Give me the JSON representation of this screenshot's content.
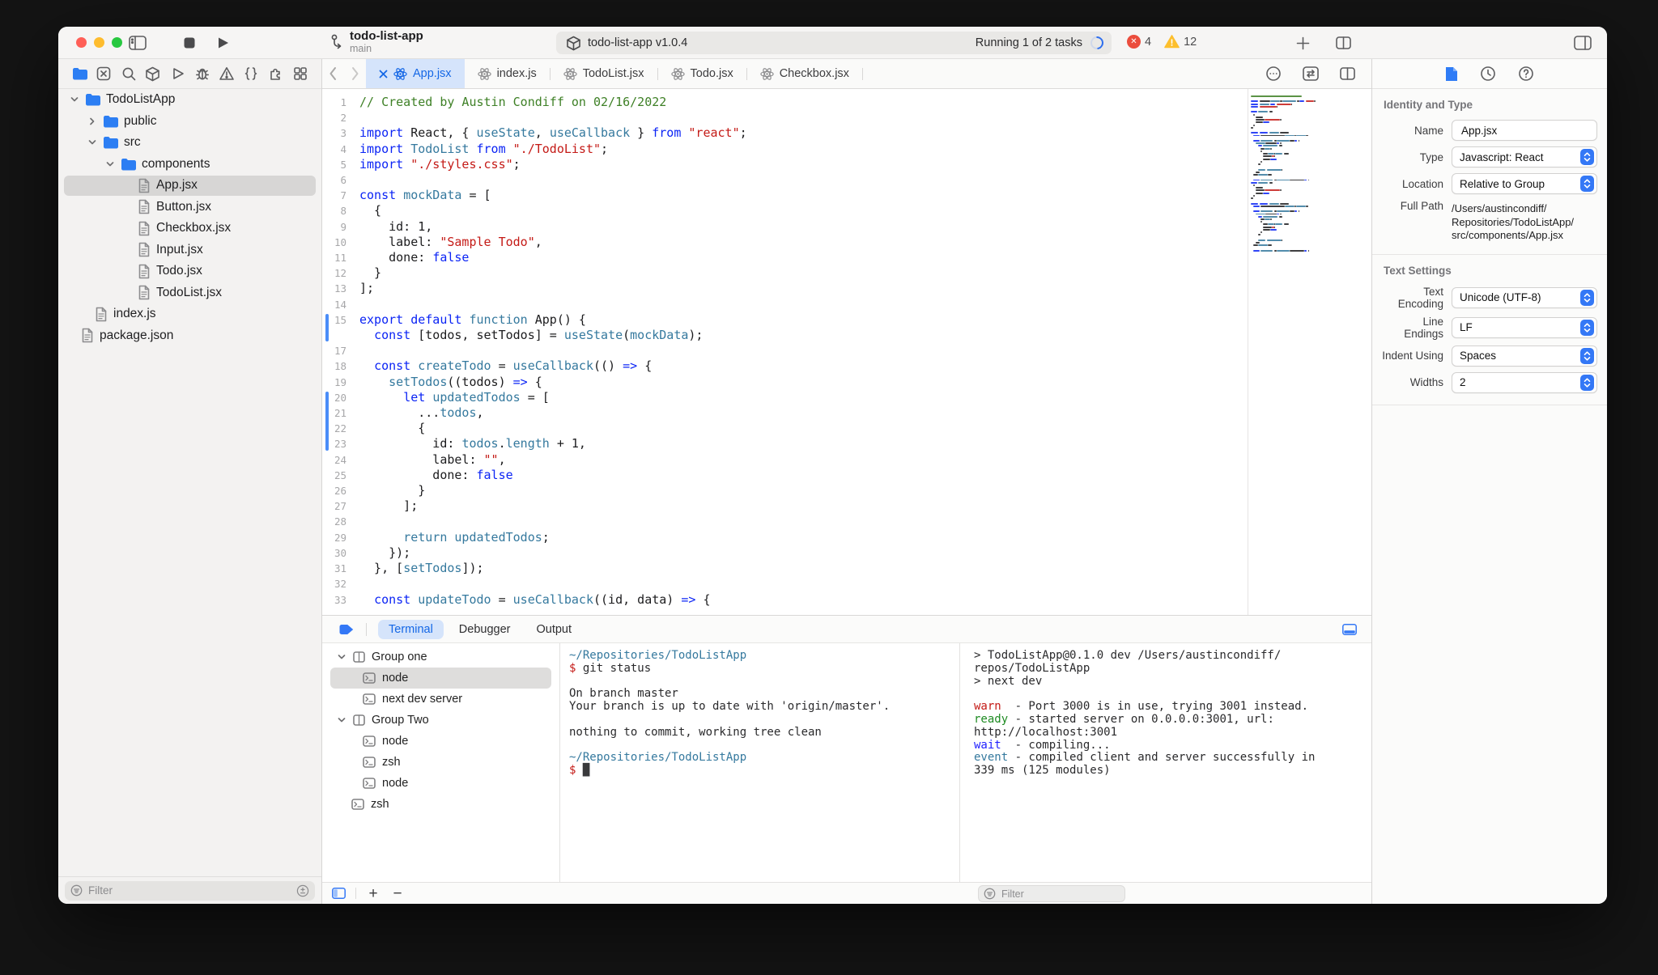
{
  "colors": {
    "accent": "#3478f6",
    "selection": "#d5e4fb",
    "traffic": [
      "#ff5f57",
      "#febc2e",
      "#28c840"
    ],
    "error_badge": "#eb4d3d",
    "warning_badge": "#fdbf2d",
    "code": {
      "p": "#1c1c1e",
      "kw": "#0b24f5",
      "fn": "#35799e",
      "str": "#c41a16",
      "c": "#3e8026"
    },
    "term": {
      "t": "#2a2a2c",
      "path": "#35799e",
      "dollar": "#c41a16",
      "warn": "#c41a16",
      "ready": "#1e8b22",
      "wait": "#1f1fff",
      "event": "#35799e",
      "cursor": "#3a3a3c"
    }
  },
  "toolbar": {
    "project_name": "todo-list-app",
    "branch": "main",
    "status": {
      "package_label": "todo-list-app v1.0.4",
      "running_label": "Running 1 of 2 tasks",
      "error_count": "4",
      "warning_count": "12"
    }
  },
  "navigator": {
    "icons": [
      "folder",
      "x-square",
      "search",
      "cube",
      "play",
      "bug",
      "warning",
      "braces",
      "puzzle",
      "grid"
    ],
    "tree": [
      {
        "label": "TodoListApp",
        "icon": "folder",
        "chevron": "down",
        "indent": 14
      },
      {
        "label": "public",
        "icon": "folder",
        "chevron": "right",
        "indent": 36
      },
      {
        "label": "src",
        "icon": "folder",
        "chevron": "down",
        "indent": 36
      },
      {
        "label": "components",
        "icon": "folder",
        "chevron": "down",
        "indent": 58
      },
      {
        "label": "App.jsx",
        "icon": "file",
        "indent": 98,
        "selected": true
      },
      {
        "label": "Button.jsx",
        "icon": "file",
        "indent": 98
      },
      {
        "label": "Checkbox.jsx",
        "icon": "file",
        "indent": 98
      },
      {
        "label": "Input.jsx",
        "icon": "file",
        "indent": 98
      },
      {
        "label": "Todo.jsx",
        "icon": "file",
        "indent": 98
      },
      {
        "label": "TodoList.jsx",
        "icon": "file",
        "indent": 98
      },
      {
        "label": "index.js",
        "icon": "file",
        "indent": 45
      },
      {
        "label": "package.json",
        "icon": "file",
        "indent": 28
      }
    ],
    "filter_placeholder": "Filter"
  },
  "tabs": [
    {
      "label": "App.jsx",
      "active": true
    },
    {
      "label": "index.js"
    },
    {
      "label": "TodoList.jsx"
    },
    {
      "label": "Todo.jsx"
    },
    {
      "label": "Checkbox.jsx"
    }
  ],
  "editor": {
    "change_bars": [
      {
        "from": 15,
        "to": 16
      },
      {
        "from": 20,
        "to": 23
      }
    ],
    "lines": [
      {
        "n": "1",
        "t": [
          [
            "c",
            "// Created by Austin Condiff on 02/16/2022"
          ]
        ]
      },
      {
        "n": "2",
        "t": []
      },
      {
        "n": "3",
        "t": [
          [
            "kw",
            "import"
          ],
          [
            "p",
            " React, { "
          ],
          [
            "fn",
            "useState"
          ],
          [
            "p",
            ", "
          ],
          [
            "fn",
            "useCallback"
          ],
          [
            "p",
            " } "
          ],
          [
            "kw",
            "from"
          ],
          [
            "p",
            " "
          ],
          [
            "str",
            "\"react\""
          ],
          [
            "p",
            ";"
          ]
        ]
      },
      {
        "n": "4",
        "t": [
          [
            "kw",
            "import"
          ],
          [
            "p",
            " "
          ],
          [
            "fn",
            "TodoList"
          ],
          [
            "p",
            " "
          ],
          [
            "kw",
            "from"
          ],
          [
            "p",
            " "
          ],
          [
            "str",
            "\"./TodoList\""
          ],
          [
            "p",
            ";"
          ]
        ]
      },
      {
        "n": "5",
        "t": [
          [
            "kw",
            "import"
          ],
          [
            "p",
            " "
          ],
          [
            "str",
            "\"./styles.css\""
          ],
          [
            "p",
            ";"
          ]
        ]
      },
      {
        "n": "6",
        "t": []
      },
      {
        "n": "7",
        "t": [
          [
            "kw",
            "const"
          ],
          [
            "p",
            " "
          ],
          [
            "fn",
            "mockData"
          ],
          [
            "p",
            " = ["
          ]
        ]
      },
      {
        "n": "8",
        "t": [
          [
            "p",
            "  {"
          ]
        ]
      },
      {
        "n": "9",
        "t": [
          [
            "p",
            "    id: 1,"
          ]
        ]
      },
      {
        "n": "10",
        "t": [
          [
            "p",
            "    label: "
          ],
          [
            "str",
            "\"Sample Todo\""
          ],
          [
            "p",
            ","
          ]
        ]
      },
      {
        "n": "11",
        "t": [
          [
            "p",
            "    done: "
          ],
          [
            "kw",
            "false"
          ]
        ]
      },
      {
        "n": "12",
        "t": [
          [
            "p",
            "  }"
          ]
        ]
      },
      {
        "n": "13",
        "t": [
          [
            "p",
            "];"
          ]
        ]
      },
      {
        "n": "14",
        "t": []
      },
      {
        "n": "15",
        "t": [
          [
            "kw",
            "export"
          ],
          [
            "p",
            " "
          ],
          [
            "kw",
            "default"
          ],
          [
            "p",
            " "
          ],
          [
            "fn",
            "function"
          ],
          [
            "p",
            " App() {"
          ]
        ]
      },
      {
        "n": "",
        "t": [
          [
            "p",
            "  "
          ],
          [
            "kw",
            "const"
          ],
          [
            "p",
            " [todos, setTodos] = "
          ],
          [
            "fn",
            "useState"
          ],
          [
            "p",
            "("
          ],
          [
            "fn",
            "mockData"
          ],
          [
            "p",
            ");"
          ]
        ]
      },
      {
        "n": "17",
        "t": []
      },
      {
        "n": "18",
        "t": [
          [
            "p",
            "  "
          ],
          [
            "kw",
            "const"
          ],
          [
            "p",
            " "
          ],
          [
            "fn",
            "createTodo"
          ],
          [
            "p",
            " = "
          ],
          [
            "fn",
            "useCallback"
          ],
          [
            "p",
            "(() "
          ],
          [
            "kw",
            "=>"
          ],
          [
            "p",
            " {"
          ]
        ]
      },
      {
        "n": "19",
        "t": [
          [
            "p",
            "    "
          ],
          [
            "fn",
            "setTodos"
          ],
          [
            "p",
            "((todos) "
          ],
          [
            "kw",
            "=>"
          ],
          [
            "p",
            " {"
          ]
        ]
      },
      {
        "n": "20",
        "t": [
          [
            "p",
            "      "
          ],
          [
            "kw",
            "let"
          ],
          [
            "p",
            " "
          ],
          [
            "fn",
            "updatedTodos"
          ],
          [
            "p",
            " = ["
          ]
        ]
      },
      {
        "n": "21",
        "t": [
          [
            "p",
            "        ..."
          ],
          [
            "fn",
            "todos"
          ],
          [
            "p",
            ","
          ]
        ]
      },
      {
        "n": "22",
        "t": [
          [
            "p",
            "        {"
          ]
        ]
      },
      {
        "n": "23",
        "t": [
          [
            "p",
            "          id: "
          ],
          [
            "fn",
            "todos"
          ],
          [
            "p",
            "."
          ],
          [
            "fn",
            "length"
          ],
          [
            "p",
            " + 1,"
          ]
        ]
      },
      {
        "n": "24",
        "t": [
          [
            "p",
            "          label: "
          ],
          [
            "str",
            "\"\""
          ],
          [
            "p",
            ","
          ]
        ]
      },
      {
        "n": "25",
        "t": [
          [
            "p",
            "          done: "
          ],
          [
            "kw",
            "false"
          ]
        ]
      },
      {
        "n": "26",
        "t": [
          [
            "p",
            "        }"
          ]
        ]
      },
      {
        "n": "27",
        "t": [
          [
            "p",
            "      ];"
          ]
        ]
      },
      {
        "n": "28",
        "t": []
      },
      {
        "n": "29",
        "t": [
          [
            "p",
            "      "
          ],
          [
            "fn",
            "return"
          ],
          [
            "p",
            " "
          ],
          [
            "fn",
            "updatedTodos"
          ],
          [
            "p",
            ";"
          ]
        ]
      },
      {
        "n": "30",
        "t": [
          [
            "p",
            "    });"
          ]
        ]
      },
      {
        "n": "31",
        "t": [
          [
            "p",
            "  }, ["
          ],
          [
            "fn",
            "setTodos"
          ],
          [
            "p",
            "]);"
          ]
        ]
      },
      {
        "n": "32",
        "t": []
      },
      {
        "n": "33",
        "t": [
          [
            "p",
            "  "
          ],
          [
            "kw",
            "const"
          ],
          [
            "p",
            " "
          ],
          [
            "fn",
            "updateTodo"
          ],
          [
            "p",
            " = "
          ],
          [
            "fn",
            "useCallback"
          ],
          [
            "p",
            "((id, data) "
          ],
          [
            "kw",
            "=>"
          ],
          [
            "p",
            " {"
          ]
        ]
      }
    ]
  },
  "inspector": {
    "identity": {
      "title": "Identity and Type",
      "rows": [
        {
          "label": "Name",
          "value": "App.jsx",
          "control": "input"
        },
        {
          "label": "Type",
          "value": "Javascript: React",
          "control": "select"
        },
        {
          "label": "Location",
          "value": "Relative to Group",
          "control": "select"
        },
        {
          "label": "Full Path",
          "control": "text",
          "value_lines": [
            "/Users/austincondiff/",
            "Repositories/TodoListApp/",
            "src/components/App.jsx"
          ]
        }
      ]
    },
    "text_settings": {
      "title": "Text Settings",
      "rows": [
        {
          "label": "Text Encoding",
          "value": "Unicode (UTF-8)",
          "control": "select"
        },
        {
          "label": "Line Endings",
          "value": "LF",
          "control": "select"
        },
        {
          "label": "Indent Using",
          "value": "Spaces",
          "control": "select"
        },
        {
          "label": "Widths",
          "value": "2",
          "control": "select"
        }
      ]
    }
  },
  "terminal": {
    "tabs": [
      {
        "label": "Terminal",
        "active": true
      },
      {
        "label": "Debugger"
      },
      {
        "label": "Output"
      }
    ],
    "groups": [
      {
        "type": "group",
        "label": "Group one"
      },
      {
        "type": "session",
        "label": "node",
        "selected": true
      },
      {
        "type": "session",
        "label": "next dev server"
      },
      {
        "type": "group",
        "label": "Group Two"
      },
      {
        "type": "session",
        "label": "node"
      },
      {
        "type": "session",
        "label": "zsh"
      },
      {
        "type": "session",
        "label": "node"
      },
      {
        "type": "session-root",
        "label": "zsh"
      }
    ],
    "pane1_lines": [
      [
        [
          "path",
          "~/Repositories/TodoListApp"
        ]
      ],
      [
        [
          "dollar",
          "$"
        ],
        [
          "t",
          " git status"
        ]
      ],
      [],
      [
        [
          "t",
          "On branch master"
        ]
      ],
      [
        [
          "t",
          "Your branch is up to date with 'origin/master'."
        ]
      ],
      [],
      [
        [
          "t",
          "nothing to commit, working tree clean"
        ]
      ],
      [],
      [
        [
          "path",
          "~/Repositories/TodoListApp"
        ]
      ],
      [
        [
          "dollar",
          "$ "
        ],
        [
          "cursor",
          "█"
        ]
      ]
    ],
    "pane2_lines": [
      [
        [
          "t",
          "> TodoListApp@0.1.0 dev /Users/austincondiff/"
        ]
      ],
      [
        [
          "t",
          "repos/TodoListApp"
        ]
      ],
      [
        [
          "t",
          "> next dev"
        ]
      ],
      [],
      [
        [
          "warn",
          "warn"
        ],
        [
          "t",
          "  - Port 3000 is in use, trying 3001 instead."
        ]
      ],
      [
        [
          "ready",
          "ready"
        ],
        [
          "t",
          " - started server on 0.0.0.0:3001, url:"
        ]
      ],
      [
        [
          "t",
          "http://localhost:3001"
        ]
      ],
      [
        [
          "wait",
          "wait"
        ],
        [
          "t",
          "  - compiling..."
        ]
      ],
      [
        [
          "event",
          "event"
        ],
        [
          "t",
          " - compiled client and server successfully in"
        ]
      ],
      [
        [
          "t",
          "339 ms (125 modules)"
        ]
      ]
    ],
    "filter_placeholder": "Filter"
  }
}
